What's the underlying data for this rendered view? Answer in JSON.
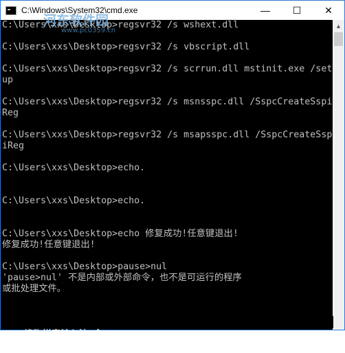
{
  "window": {
    "title": "C:\\Windows\\System32\\cmd.exe",
    "minimize_symbol": "—",
    "maximize_symbol": "☐",
    "close_symbol": "✕",
    "app_icon": "cmd-icon"
  },
  "watermark": {
    "text": "河东软件园",
    "url": "www.pc0359.cn"
  },
  "console": {
    "lines": [
      "C:\\Users\\xxs\\Desktop>regsvr32 /s wshext.dll",
      "",
      "C:\\Users\\xxs\\Desktop>regsvr32 /s vbscript.dll",
      "",
      "C:\\Users\\xxs\\Desktop>regsvr32 /s scrrun.dll mstinit.exe /set",
      "up",
      "",
      "C:\\Users\\xxs\\Desktop>regsvr32 /s msnsspc.dll /SspcCreateSspi",
      "Reg",
      "",
      "C:\\Users\\xxs\\Desktop>regsvr32 /s msapsspc.dll /SspcCreateSsp",
      "iReg",
      "",
      "C:\\Users\\xxs\\Desktop>echo.",
      "",
      "",
      "C:\\Users\\xxs\\Desktop>echo.",
      "",
      "",
      "C:\\Users\\xxs\\Desktop>echo 修复成功!任意键退出!",
      "修复成功!任意键退出!",
      "",
      "C:\\Users\\xxs\\Desktop>pause>nul",
      "'pause>nul' 不是内部或外部命令，也不是可运行的程序",
      "或批处理文件。",
      ""
    ]
  },
  "ime": {
    "label": "搜狗拼音输入法 全 :"
  }
}
